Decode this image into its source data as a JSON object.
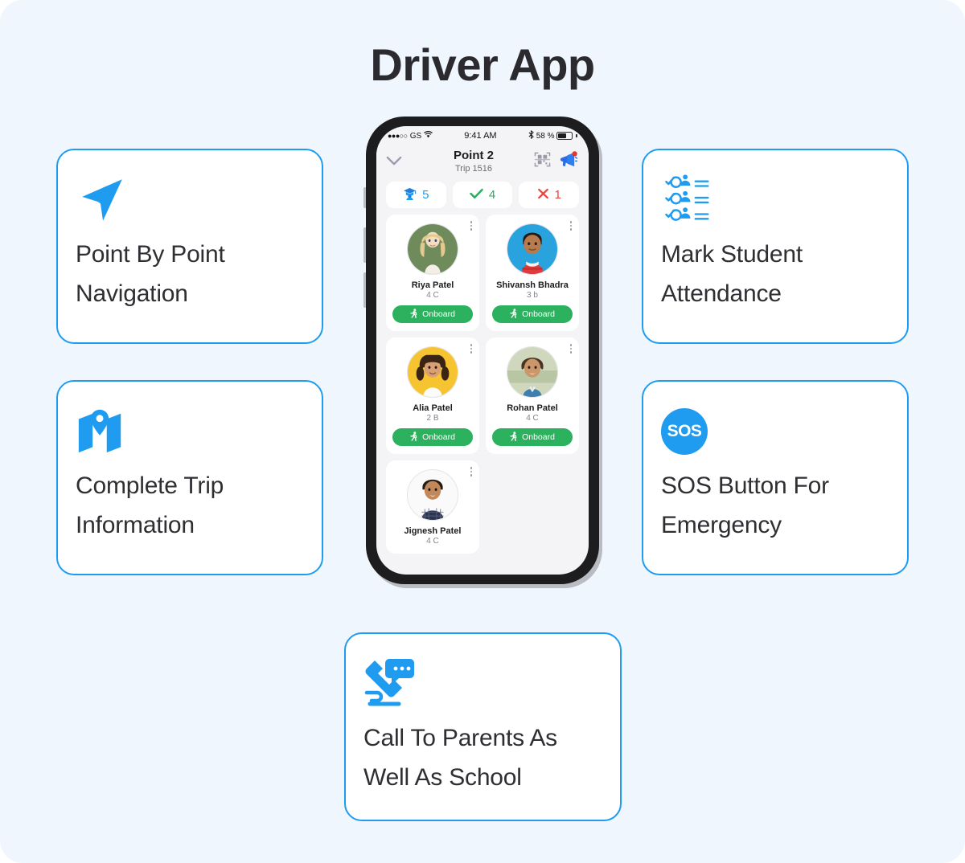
{
  "page": {
    "title": "Driver App",
    "background_color": "#eff6fd",
    "accent_color": "#1f9cf0"
  },
  "feature_cards": [
    {
      "id": "navigation",
      "icon": "navigation-arrow-icon",
      "label": "Point By Point Navigation",
      "side": "left"
    },
    {
      "id": "trip-info",
      "icon": "map-pin-icon",
      "label": "Complete Trip Information",
      "side": "left"
    },
    {
      "id": "attendance",
      "icon": "attendance-checklist-icon",
      "label": "Mark Student Attendance",
      "side": "right"
    },
    {
      "id": "sos",
      "icon": "sos-badge-icon",
      "label": "SOS Button For Emergency",
      "side": "right",
      "badge_text": "SOS"
    },
    {
      "id": "call",
      "icon": "phone-chat-icon",
      "label": "Call To Parents As Well As School",
      "side": "bottom"
    }
  ],
  "phone": {
    "status_bar": {
      "signal_dots": "●●●○○",
      "carrier": "GS",
      "wifi_icon": "wifi-icon",
      "time": "9:41 AM",
      "bluetooth_icon": "bluetooth-icon",
      "battery_text": "58 %",
      "battery_percent": 58
    },
    "header": {
      "back_icon": "chevron-down-icon",
      "title": "Point 2",
      "subtitle": "Trip 1516",
      "actions": [
        {
          "name": "qr-scan-icon",
          "label": "qr-scan"
        },
        {
          "name": "megaphone-icon",
          "label": "announcement"
        }
      ]
    },
    "stats": [
      {
        "id": "total",
        "icon": "student-cap-icon",
        "value": "5",
        "color": "#1f9cf0"
      },
      {
        "id": "present",
        "icon": "check-icon",
        "value": "4",
        "color": "#27ae60"
      },
      {
        "id": "absent",
        "icon": "cross-icon",
        "value": "1",
        "color": "#e8453c"
      }
    ],
    "students": [
      {
        "name": "Riya Patel",
        "class": "4 C",
        "action": "Onboard",
        "avatar": "girl-blonde"
      },
      {
        "name": "Shivansh Bhadra",
        "class": "3 b",
        "action": "Onboard",
        "avatar": "boy-red-shirt"
      },
      {
        "name": "Alia Patel",
        "class": "2 B",
        "action": "Onboard",
        "avatar": "girl-braids"
      },
      {
        "name": "Rohan Patel",
        "class": "4 C",
        "action": "Onboard",
        "avatar": "boy-denim"
      },
      {
        "name": "Jignesh Patel",
        "class": "4 C",
        "action": "",
        "avatar": "boy-check-shirt"
      }
    ]
  }
}
